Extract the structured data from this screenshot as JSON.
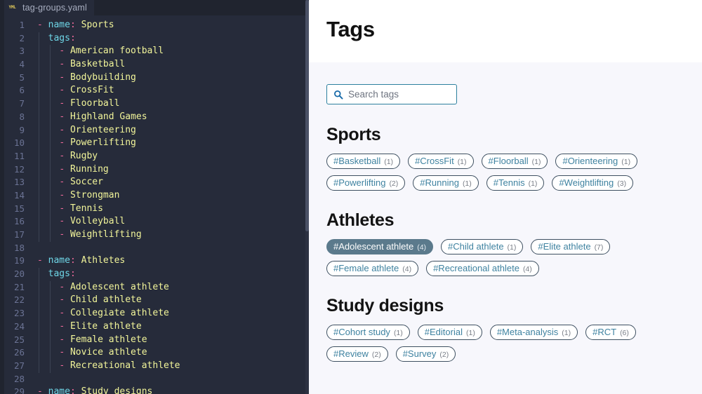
{
  "editor": {
    "tab": {
      "filename": "tag-groups.yaml",
      "icon": "yaml-file-icon",
      "icon_text": "YML"
    },
    "lines": [
      {
        "num": "1",
        "indent": 0,
        "dash": true,
        "key": "name",
        "value": "Sports"
      },
      {
        "num": "2",
        "indent": 1,
        "dash": false,
        "key": "tags",
        "value": ""
      },
      {
        "num": "3",
        "indent": 2,
        "dash": true,
        "key": "",
        "value": "American football"
      },
      {
        "num": "4",
        "indent": 2,
        "dash": true,
        "key": "",
        "value": "Basketball"
      },
      {
        "num": "5",
        "indent": 2,
        "dash": true,
        "key": "",
        "value": "Bodybuilding"
      },
      {
        "num": "6",
        "indent": 2,
        "dash": true,
        "key": "",
        "value": "CrossFit"
      },
      {
        "num": "7",
        "indent": 2,
        "dash": true,
        "key": "",
        "value": "Floorball"
      },
      {
        "num": "8",
        "indent": 2,
        "dash": true,
        "key": "",
        "value": "Highland Games"
      },
      {
        "num": "9",
        "indent": 2,
        "dash": true,
        "key": "",
        "value": "Orienteering"
      },
      {
        "num": "10",
        "indent": 2,
        "dash": true,
        "key": "",
        "value": "Powerlifting"
      },
      {
        "num": "11",
        "indent": 2,
        "dash": true,
        "key": "",
        "value": "Rugby"
      },
      {
        "num": "12",
        "indent": 2,
        "dash": true,
        "key": "",
        "value": "Running"
      },
      {
        "num": "13",
        "indent": 2,
        "dash": true,
        "key": "",
        "value": "Soccer"
      },
      {
        "num": "14",
        "indent": 2,
        "dash": true,
        "key": "",
        "value": "Strongman"
      },
      {
        "num": "15",
        "indent": 2,
        "dash": true,
        "key": "",
        "value": "Tennis"
      },
      {
        "num": "16",
        "indent": 2,
        "dash": true,
        "key": "",
        "value": "Volleyball"
      },
      {
        "num": "17",
        "indent": 2,
        "dash": true,
        "key": "",
        "value": "Weightlifting"
      },
      {
        "num": "18",
        "indent": 0,
        "dash": false,
        "key": "",
        "value": ""
      },
      {
        "num": "19",
        "indent": 0,
        "dash": true,
        "key": "name",
        "value": "Athletes"
      },
      {
        "num": "20",
        "indent": 1,
        "dash": false,
        "key": "tags",
        "value": ""
      },
      {
        "num": "21",
        "indent": 2,
        "dash": true,
        "key": "",
        "value": "Adolescent athlete"
      },
      {
        "num": "22",
        "indent": 2,
        "dash": true,
        "key": "",
        "value": "Child athlete"
      },
      {
        "num": "23",
        "indent": 2,
        "dash": true,
        "key": "",
        "value": "Collegiate athlete"
      },
      {
        "num": "24",
        "indent": 2,
        "dash": true,
        "key": "",
        "value": "Elite athlete"
      },
      {
        "num": "25",
        "indent": 2,
        "dash": true,
        "key": "",
        "value": "Female athlete"
      },
      {
        "num": "26",
        "indent": 2,
        "dash": true,
        "key": "",
        "value": "Novice athlete"
      },
      {
        "num": "27",
        "indent": 2,
        "dash": true,
        "key": "",
        "value": "Recreational athlete"
      },
      {
        "num": "28",
        "indent": 0,
        "dash": false,
        "key": "",
        "value": ""
      },
      {
        "num": "29",
        "indent": 0,
        "dash": true,
        "key": "name",
        "value": "Study designs"
      }
    ]
  },
  "web": {
    "title": "Tags",
    "search": {
      "placeholder": "Search tags",
      "value": "",
      "icon": "search-icon"
    },
    "sections": [
      {
        "heading": "Sports",
        "tags": [
          {
            "name": "#Basketball",
            "count": "(1)",
            "active": false
          },
          {
            "name": "#CrossFit",
            "count": "(1)",
            "active": false
          },
          {
            "name": "#Floorball",
            "count": "(1)",
            "active": false
          },
          {
            "name": "#Orienteering",
            "count": "(1)",
            "active": false
          },
          {
            "name": "#Powerlifting",
            "count": "(2)",
            "active": false
          },
          {
            "name": "#Running",
            "count": "(1)",
            "active": false
          },
          {
            "name": "#Tennis",
            "count": "(1)",
            "active": false
          },
          {
            "name": "#Weightlifting",
            "count": "(3)",
            "active": false
          }
        ]
      },
      {
        "heading": "Athletes",
        "tags": [
          {
            "name": "#Adolescent athlete",
            "count": "(4)",
            "active": true
          },
          {
            "name": "#Child athlete",
            "count": "(1)",
            "active": false
          },
          {
            "name": "#Elite athlete",
            "count": "(7)",
            "active": false
          },
          {
            "name": "#Female athlete",
            "count": "(4)",
            "active": false
          },
          {
            "name": "#Recreational athlete",
            "count": "(4)",
            "active": false
          }
        ]
      },
      {
        "heading": "Study designs",
        "tags": [
          {
            "name": "#Cohort study",
            "count": "(1)",
            "active": false
          },
          {
            "name": "#Editorial",
            "count": "(1)",
            "active": false
          },
          {
            "name": "#Meta-analysis",
            "count": "(1)",
            "active": false
          },
          {
            "name": "#RCT",
            "count": "(6)",
            "active": false
          },
          {
            "name": "#Review",
            "count": "(2)",
            "active": false
          },
          {
            "name": "#Survey",
            "count": "(2)",
            "active": false
          }
        ]
      }
    ]
  },
  "colors": {
    "editor_bg": "#262b3a",
    "editor_chrome": "#20242f",
    "token_key": "#6fd7e8",
    "token_punct": "#ef6a9b",
    "token_value": "#f2f59a",
    "line_number": "#6b7394",
    "page_bg": "#f7f7fc",
    "header_bg": "#ffffff",
    "pill_border": "#3d4f60",
    "pill_text": "#3e82a0",
    "pill_active_bg": "#5b7a8c",
    "search_border": "#2c7f9e"
  }
}
